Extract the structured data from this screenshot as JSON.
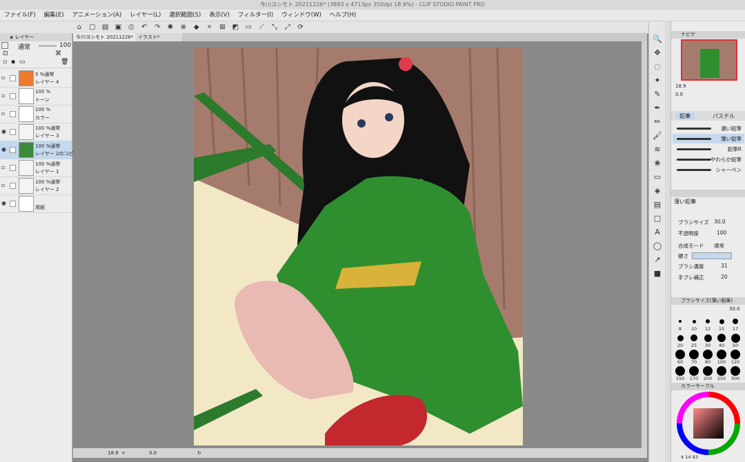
{
  "window": {
    "title": "今川ヨシモト  20211226* (3893 x 4713px 350dpi 18.9%)  - CLIP STUDIO PAINT PRO"
  },
  "menu": [
    "ファイル(F)",
    "編集(E)",
    "アニメーション(A)",
    "レイヤー(L)",
    "選択範囲(S)",
    "表示(V)",
    "フィルター(I)",
    "ウィンドウ(W)",
    "ヘルプ(H)"
  ],
  "layer_panel": {
    "tab_label": "レイヤー",
    "blend_mode": "通常",
    "opacity": "100",
    "layers": [
      {
        "name": "レイヤー 4",
        "info": "5 %通常",
        "thumb_color": "#f07a2f",
        "selected": false,
        "visible": false
      },
      {
        "name": "トーン",
        "info": "100 %",
        "thumb_color": "#ffffff",
        "selected": false,
        "visible": false
      },
      {
        "name": "カラー",
        "info": "100 %",
        "thumb_color": "#ffffff",
        "selected": false,
        "visible": false
      },
      {
        "name": "レイヤー 3",
        "info": "100 %通常",
        "thumb_color": "#f4f4f4",
        "selected": false,
        "visible": true
      },
      {
        "name": "レイヤー 2のコピー",
        "info": "100 %通常",
        "thumb_color": "#3a8a3a",
        "selected": true,
        "visible": true
      },
      {
        "name": "レイヤー 1",
        "info": "100 %通常",
        "thumb_color": "#f4f4f4",
        "selected": false,
        "visible": false
      },
      {
        "name": "レイヤー 2",
        "info": "100 %通常",
        "thumb_color": "#f4f4f4",
        "selected": false,
        "visible": false
      },
      {
        "name": "用紙",
        "info": "",
        "thumb_color": "#ffffff",
        "selected": false,
        "visible": true
      }
    ]
  },
  "document_tabs": [
    "今川ヨシモト  20211226*",
    "イラスト*"
  ],
  "status": {
    "zoom": "18.9",
    "rotation": "0.0"
  },
  "navigator": {
    "tab_label": "ナビゲ",
    "zoom": "18.9",
    "angle": "0.0"
  },
  "brush_tabs": [
    "鉛筆",
    "パステル"
  ],
  "brush_list": [
    {
      "name": "濃い鉛筆",
      "selected": false
    },
    {
      "name": "薄い鉛筆",
      "selected": true
    },
    {
      "name": "鉛筆R",
      "selected": false
    },
    {
      "name": "やわらか鉛筆",
      "selected": false
    },
    {
      "name": "シャーペン",
      "selected": false
    }
  ],
  "tool_property": {
    "title": "薄い鉛筆",
    "brush_size_label": "ブラシサイズ",
    "brush_size": "30.0",
    "opacity_label": "不透明度",
    "opacity": "100",
    "blend_label": "合成モード",
    "blend": "通常",
    "hardness_label": "硬さ",
    "density_label": "ブラシ濃度",
    "density": "31",
    "stabilization_label": "手ブレ補正",
    "stabilization": "20"
  },
  "brush_size_panel": {
    "title": "ブラシサイズ(薄い鉛筆)",
    "current": "30.0",
    "sizes": [
      "8",
      "10",
      "12",
      "15",
      "17",
      "20",
      "25",
      "30",
      "40",
      "50",
      "60",
      "70",
      "80",
      "100",
      "120",
      "150",
      "170",
      "200",
      "250",
      "300"
    ]
  },
  "color_circle": {
    "title": "カラーサークル",
    "values": [
      "4",
      "14",
      "93"
    ]
  },
  "colors": {
    "accent": "#c4d8ee",
    "panel": "#ececec",
    "canvas_bg": "#8a8a8a"
  }
}
